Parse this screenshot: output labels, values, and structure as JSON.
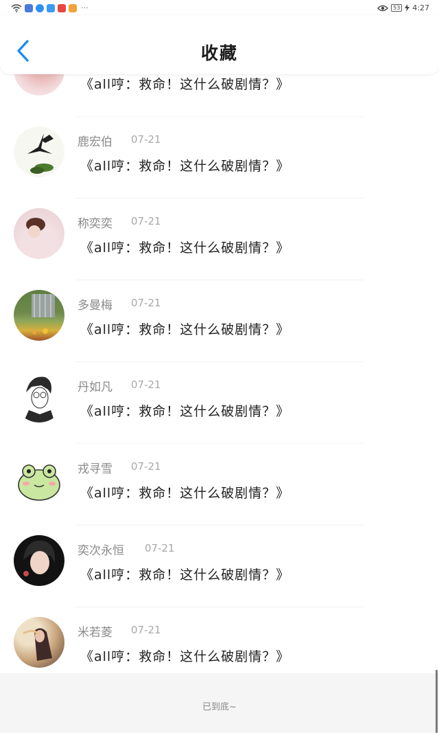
{
  "status_bar": {
    "time": "4:27",
    "battery": "53",
    "icons": [
      "wifi-icon",
      "gamepad-app-icon",
      "music-app-icon",
      "cloud-app-icon",
      "red-app-icon",
      "video-app-icon",
      "more-icon",
      "eye-icon",
      "battery-icon",
      "charging-icon"
    ]
  },
  "header": {
    "title": "收藏",
    "back_icon": "chevron-left-icon"
  },
  "article_title": "《all哼：救命！这什么破剧情？》",
  "items": [
    {
      "name": "",
      "date": "",
      "avatar_colors": [
        "#f2d7d9",
        "#e9b6b6"
      ]
    },
    {
      "name": "鹿宏伯",
      "date": "07-21",
      "avatar_colors": [
        "#f7f7f2",
        "#3a5e22"
      ]
    },
    {
      "name": "称奕奕",
      "date": "07-21",
      "avatar_colors": [
        "#f0d9dd",
        "#5a3226"
      ]
    },
    {
      "name": "多曼梅",
      "date": "07-21",
      "avatar_colors": [
        "#6f8a4a",
        "#d7b03c"
      ]
    },
    {
      "name": "丹如凡",
      "date": "07-21",
      "avatar_colors": [
        "#ffffff",
        "#2a2a2a"
      ]
    },
    {
      "name": "戎寻雪",
      "date": "07-21",
      "avatar_colors": [
        "#ffffff",
        "#c9e7a0"
      ]
    },
    {
      "name": "奕次永恒",
      "date": "07-21",
      "avatar_colors": [
        "#121212",
        "#c94b4b"
      ]
    },
    {
      "name": "米若菱",
      "date": "07-21",
      "avatar_colors": [
        "#c9a57c",
        "#3f2a28"
      ]
    }
  ],
  "footer": {
    "text": "已到底~"
  },
  "colors": {
    "accent": "#1a8cf0",
    "footer_bg": "#f6f5f6"
  }
}
